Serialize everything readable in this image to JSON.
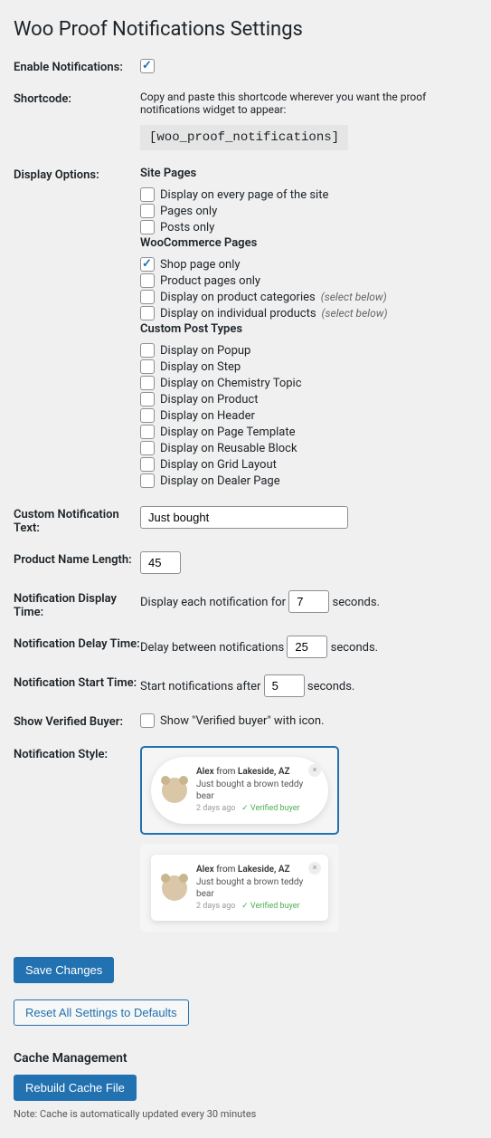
{
  "title": "Woo Proof Notifications Settings",
  "rows": {
    "enable": {
      "label": "Enable Notifications:",
      "checked": true
    },
    "shortcode": {
      "label": "Shortcode:",
      "hint": "Copy and paste this shortcode wherever you want the proof notifications widget to appear:",
      "code": "[woo_proof_notifications]"
    },
    "display": {
      "label": "Display Options:",
      "group1_title": "Site Pages",
      "group1": [
        {
          "label": "Display on every page of the site",
          "checked": false
        },
        {
          "label": "Pages only",
          "checked": false
        },
        {
          "label": "Posts only",
          "checked": false
        }
      ],
      "group2_title": "WooCommerce Pages",
      "select_below": "(select below)",
      "group2": [
        {
          "label": "Shop page only",
          "checked": true,
          "extra": false
        },
        {
          "label": "Product pages only",
          "checked": false,
          "extra": false
        },
        {
          "label": "Display on product categories",
          "checked": false,
          "extra": true
        },
        {
          "label": "Display on individual products",
          "checked": false,
          "extra": true
        }
      ],
      "group3_title": "Custom Post Types",
      "group3": [
        {
          "label": "Display on Popup",
          "checked": false
        },
        {
          "label": "Display on Step",
          "checked": false
        },
        {
          "label": "Display on Chemistry Topic",
          "checked": false
        },
        {
          "label": "Display on Product",
          "checked": false
        },
        {
          "label": "Display on Header",
          "checked": false
        },
        {
          "label": "Display on Page Template",
          "checked": false
        },
        {
          "label": "Display on Reusable Block",
          "checked": false
        },
        {
          "label": "Display on Grid Layout",
          "checked": false
        },
        {
          "label": "Display on Dealer Page",
          "checked": false
        }
      ]
    },
    "custom_text": {
      "label": "Custom Notification Text:",
      "value": "Just bought"
    },
    "name_length": {
      "label": "Product Name Length:",
      "value": "45"
    },
    "display_time": {
      "label": "Notification Display Time:",
      "prefix": "Display each notification for",
      "value": "7",
      "suffix": "seconds."
    },
    "delay_time": {
      "label": "Notification Delay Time:",
      "prefix": "Delay between notifications",
      "value": "25",
      "suffix": "seconds."
    },
    "start_time": {
      "label": "Notification Start Time:",
      "prefix": "Start notifications after",
      "value": "5",
      "suffix": "seconds."
    },
    "verified": {
      "label": "Show Verified Buyer:",
      "checkbox_label": "Show \"Verified buyer\" with icon.",
      "checked": false
    },
    "style": {
      "label": "Notification Style:"
    }
  },
  "preview": {
    "name": "Alex",
    "from": "from",
    "location": "Lakeside, AZ",
    "line2": "Just bought a brown teddy bear",
    "time": "2 days ago",
    "verified": "Verified buyer"
  },
  "buttons": {
    "save": "Save Changes",
    "reset": "Reset All Settings to Defaults",
    "rebuild": "Rebuild Cache File"
  },
  "cache": {
    "title": "Cache Management",
    "note": "Note: Cache is automatically updated every 30 minutes"
  }
}
